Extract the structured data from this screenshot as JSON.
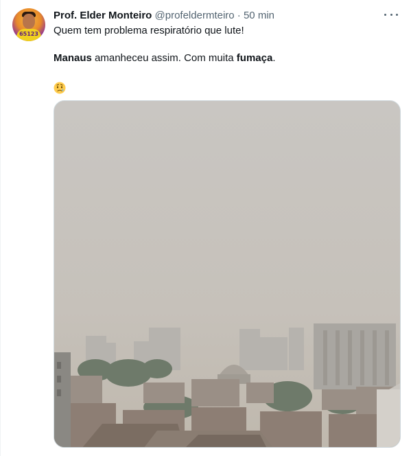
{
  "tweet": {
    "author": {
      "name": "Prof. Elder Monteiro",
      "handle": "@profeldermteiro",
      "avatar_badge": "65123"
    },
    "separator": "·",
    "time": "50 min",
    "menu_icon": "more-horizontal-icon",
    "text": {
      "line1": "Quem tem problema respiratório que lute!",
      "line2_bold_1": "Manaus",
      "line2_mid": " amanheceu assim. Com muita ",
      "line2_bold_2": "fumaça",
      "line2_end": ".",
      "emoji": "sad-but-relieved-face-emoji"
    },
    "media": {
      "type": "photo",
      "description_icon": "photo-smoky-city"
    }
  },
  "colors": {
    "text_primary": "#0f1419",
    "text_secondary": "#536471",
    "border": "#cfd9de"
  }
}
